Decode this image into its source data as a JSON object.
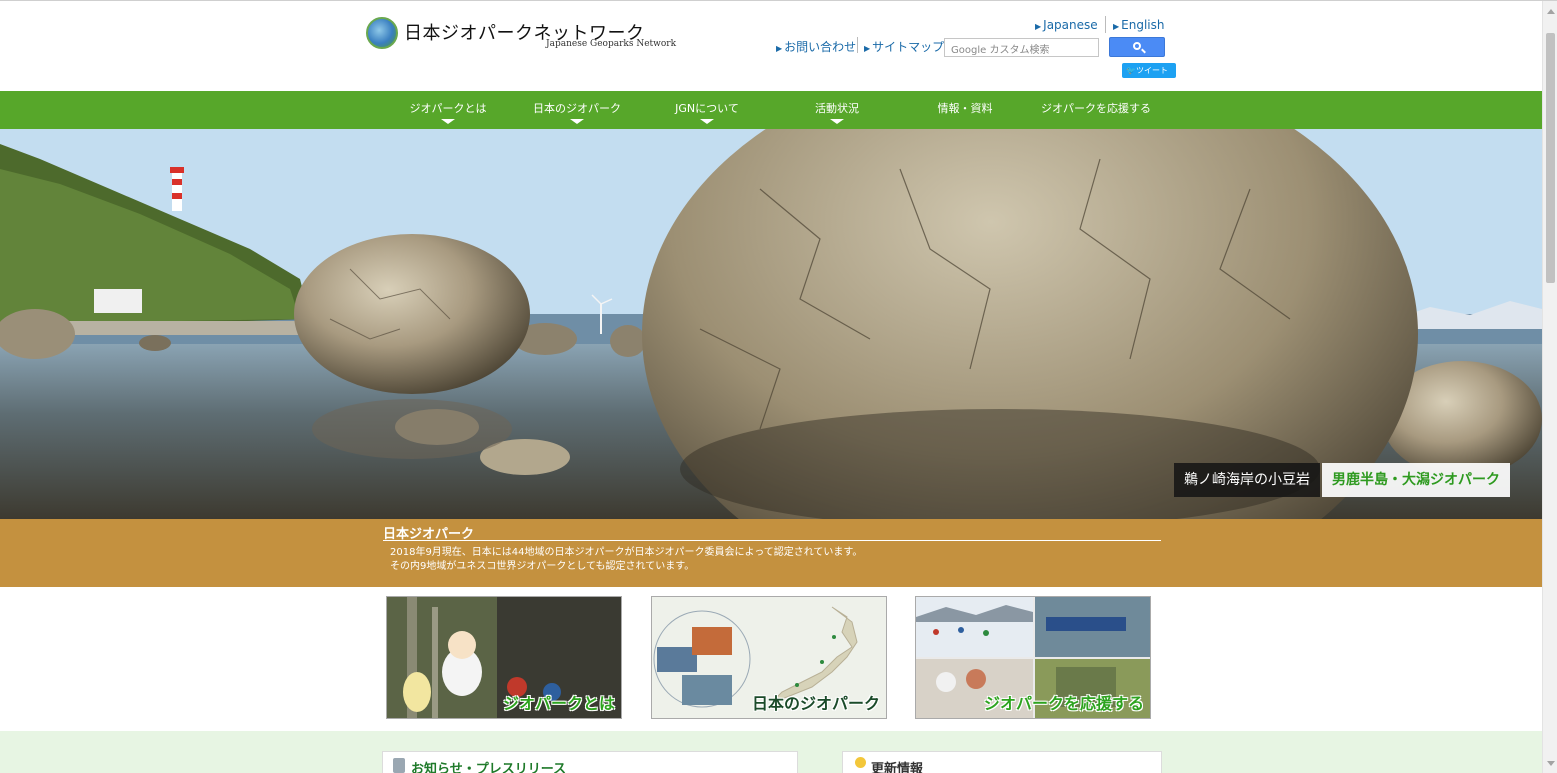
{
  "header": {
    "logo_title": "日本ジオパークネットワーク",
    "logo_sub": "Japanese Geoparks Network",
    "logo_mark_text": "JAPANESE GEOPARKS NETWORK",
    "lang_japanese": "Japanese",
    "lang_english": "English",
    "link_contact": "お問い合わせ",
    "link_sitemap": "サイトマップ",
    "search_placeholder": "Google カスタム検索",
    "tweet_label": "ツイート"
  },
  "nav": {
    "items": [
      {
        "label": "ジオパークとは"
      },
      {
        "label": "日本のジオパーク"
      },
      {
        "label": "JGNについて"
      },
      {
        "label": "活動状況"
      },
      {
        "label": "情報・資料"
      },
      {
        "label": "ジオパークを応援する"
      }
    ]
  },
  "hero": {
    "caption_place": "鵜ノ崎海岸の小豆岩",
    "caption_park": "男鹿半島・大潟ジオパーク"
  },
  "band": {
    "title": "日本ジオパーク",
    "line1": "2018年9月現在、日本には44地域の日本ジオパークが日本ジオパーク委員会によって認定されています。",
    "line2": "その内9地域がユネスコ世界ジオパークとしても認定されています。"
  },
  "cards": [
    {
      "label": "ジオパークとは"
    },
    {
      "label": "日本のジオパーク"
    },
    {
      "label": "ジオパークを応援する"
    }
  ],
  "panels": {
    "news_title": "お知らせ・プレスリリース",
    "updates_title": "更新情報"
  },
  "colors": {
    "nav_green": "#57a72a",
    "band_gold": "#c4913f",
    "link_blue": "#1a6aa8",
    "bottom_bg": "#e7f5e3"
  }
}
